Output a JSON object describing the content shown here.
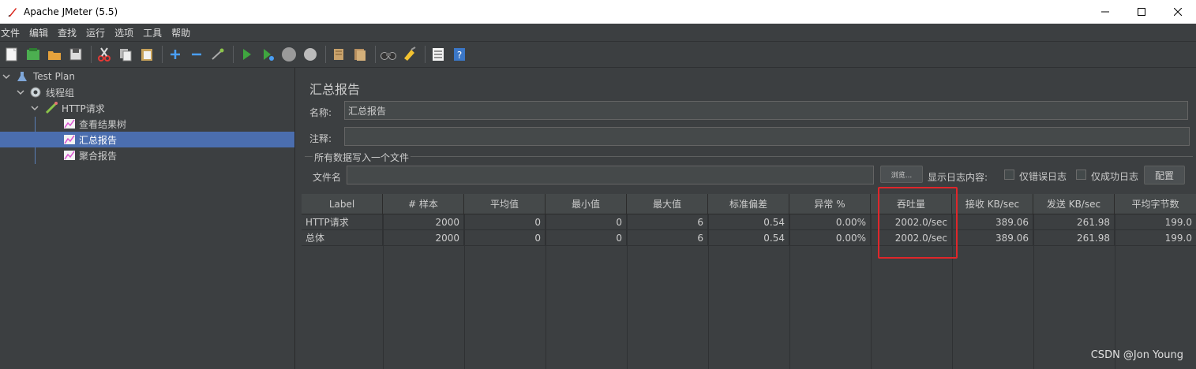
{
  "window": {
    "title": "Apache JMeter (5.5)",
    "minimize": "—",
    "maximize": "☐",
    "close": "✕"
  },
  "menu": [
    "文件",
    "编辑",
    "查找",
    "运行",
    "选项",
    "工具",
    "帮助"
  ],
  "tree": {
    "nodes": [
      {
        "label": "Test Plan"
      },
      {
        "label": "线程组"
      },
      {
        "label": "HTTP请求"
      },
      {
        "label": "查看结果树"
      },
      {
        "label": "汇总报告"
      },
      {
        "label": "聚合报告"
      }
    ]
  },
  "panel": {
    "title": "汇总报告",
    "name_label": "名称:",
    "name_value": "汇总报告",
    "comment_label": "注释:",
    "comment_value": "",
    "file_group_label": "所有数据写入一个文件",
    "file_label": "文件名",
    "file_value": "",
    "browse_button": "浏览...",
    "log_label": "显示日志内容:",
    "errors_only_label": "仅错误日志",
    "success_only_label": "仅成功日志",
    "config_button": "配置"
  },
  "table": {
    "columns": [
      "Label",
      "# 样本",
      "平均值",
      "最小值",
      "最大值",
      "标准偏差",
      "异常 %",
      "吞吐量",
      "接收 KB/sec",
      "发送 KB/sec",
      "平均字节数"
    ],
    "rows": [
      [
        "HTTP请求",
        "2000",
        "0",
        "0",
        "6",
        "0.54",
        "0.00%",
        "2002.0/sec",
        "389.06",
        "261.98",
        "199.0"
      ],
      [
        "总体",
        "2000",
        "0",
        "0",
        "6",
        "0.54",
        "0.00%",
        "2002.0/sec",
        "389.06",
        "261.98",
        "199.0"
      ]
    ]
  },
  "watermark": "CSDN @Jon Young",
  "colors": {
    "background": "#3c3f41",
    "selection": "#4b6eaf",
    "highlight_box": "#e0262a"
  }
}
